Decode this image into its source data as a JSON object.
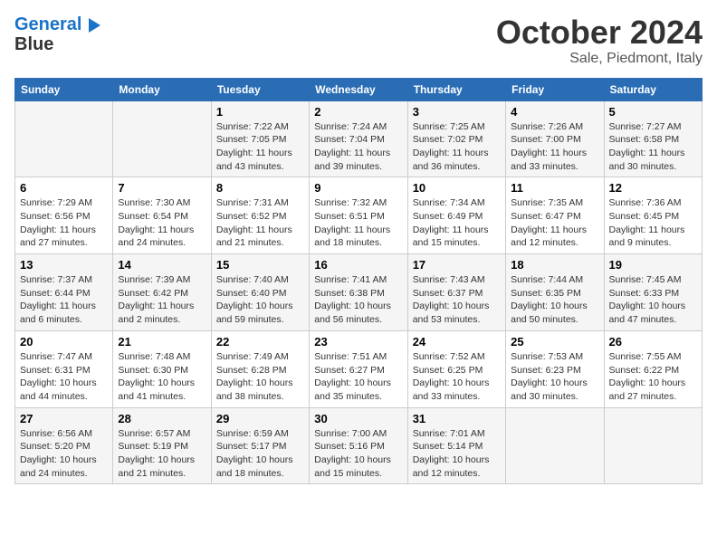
{
  "logo": {
    "line1": "General",
    "line2": "Blue"
  },
  "title": "October 2024",
  "location": "Sale, Piedmont, Italy",
  "headers": [
    "Sunday",
    "Monday",
    "Tuesday",
    "Wednesday",
    "Thursday",
    "Friday",
    "Saturday"
  ],
  "weeks": [
    [
      {
        "day": "",
        "sunrise": "",
        "sunset": "",
        "daylight": ""
      },
      {
        "day": "",
        "sunrise": "",
        "sunset": "",
        "daylight": ""
      },
      {
        "day": "1",
        "sunrise": "Sunrise: 7:22 AM",
        "sunset": "Sunset: 7:05 PM",
        "daylight": "Daylight: 11 hours and 43 minutes."
      },
      {
        "day": "2",
        "sunrise": "Sunrise: 7:24 AM",
        "sunset": "Sunset: 7:04 PM",
        "daylight": "Daylight: 11 hours and 39 minutes."
      },
      {
        "day": "3",
        "sunrise": "Sunrise: 7:25 AM",
        "sunset": "Sunset: 7:02 PM",
        "daylight": "Daylight: 11 hours and 36 minutes."
      },
      {
        "day": "4",
        "sunrise": "Sunrise: 7:26 AM",
        "sunset": "Sunset: 7:00 PM",
        "daylight": "Daylight: 11 hours and 33 minutes."
      },
      {
        "day": "5",
        "sunrise": "Sunrise: 7:27 AM",
        "sunset": "Sunset: 6:58 PM",
        "daylight": "Daylight: 11 hours and 30 minutes."
      }
    ],
    [
      {
        "day": "6",
        "sunrise": "Sunrise: 7:29 AM",
        "sunset": "Sunset: 6:56 PM",
        "daylight": "Daylight: 11 hours and 27 minutes."
      },
      {
        "day": "7",
        "sunrise": "Sunrise: 7:30 AM",
        "sunset": "Sunset: 6:54 PM",
        "daylight": "Daylight: 11 hours and 24 minutes."
      },
      {
        "day": "8",
        "sunrise": "Sunrise: 7:31 AM",
        "sunset": "Sunset: 6:52 PM",
        "daylight": "Daylight: 11 hours and 21 minutes."
      },
      {
        "day": "9",
        "sunrise": "Sunrise: 7:32 AM",
        "sunset": "Sunset: 6:51 PM",
        "daylight": "Daylight: 11 hours and 18 minutes."
      },
      {
        "day": "10",
        "sunrise": "Sunrise: 7:34 AM",
        "sunset": "Sunset: 6:49 PM",
        "daylight": "Daylight: 11 hours and 15 minutes."
      },
      {
        "day": "11",
        "sunrise": "Sunrise: 7:35 AM",
        "sunset": "Sunset: 6:47 PM",
        "daylight": "Daylight: 11 hours and 12 minutes."
      },
      {
        "day": "12",
        "sunrise": "Sunrise: 7:36 AM",
        "sunset": "Sunset: 6:45 PM",
        "daylight": "Daylight: 11 hours and 9 minutes."
      }
    ],
    [
      {
        "day": "13",
        "sunrise": "Sunrise: 7:37 AM",
        "sunset": "Sunset: 6:44 PM",
        "daylight": "Daylight: 11 hours and 6 minutes."
      },
      {
        "day": "14",
        "sunrise": "Sunrise: 7:39 AM",
        "sunset": "Sunset: 6:42 PM",
        "daylight": "Daylight: 11 hours and 2 minutes."
      },
      {
        "day": "15",
        "sunrise": "Sunrise: 7:40 AM",
        "sunset": "Sunset: 6:40 PM",
        "daylight": "Daylight: 10 hours and 59 minutes."
      },
      {
        "day": "16",
        "sunrise": "Sunrise: 7:41 AM",
        "sunset": "Sunset: 6:38 PM",
        "daylight": "Daylight: 10 hours and 56 minutes."
      },
      {
        "day": "17",
        "sunrise": "Sunrise: 7:43 AM",
        "sunset": "Sunset: 6:37 PM",
        "daylight": "Daylight: 10 hours and 53 minutes."
      },
      {
        "day": "18",
        "sunrise": "Sunrise: 7:44 AM",
        "sunset": "Sunset: 6:35 PM",
        "daylight": "Daylight: 10 hours and 50 minutes."
      },
      {
        "day": "19",
        "sunrise": "Sunrise: 7:45 AM",
        "sunset": "Sunset: 6:33 PM",
        "daylight": "Daylight: 10 hours and 47 minutes."
      }
    ],
    [
      {
        "day": "20",
        "sunrise": "Sunrise: 7:47 AM",
        "sunset": "Sunset: 6:31 PM",
        "daylight": "Daylight: 10 hours and 44 minutes."
      },
      {
        "day": "21",
        "sunrise": "Sunrise: 7:48 AM",
        "sunset": "Sunset: 6:30 PM",
        "daylight": "Daylight: 10 hours and 41 minutes."
      },
      {
        "day": "22",
        "sunrise": "Sunrise: 7:49 AM",
        "sunset": "Sunset: 6:28 PM",
        "daylight": "Daylight: 10 hours and 38 minutes."
      },
      {
        "day": "23",
        "sunrise": "Sunrise: 7:51 AM",
        "sunset": "Sunset: 6:27 PM",
        "daylight": "Daylight: 10 hours and 35 minutes."
      },
      {
        "day": "24",
        "sunrise": "Sunrise: 7:52 AM",
        "sunset": "Sunset: 6:25 PM",
        "daylight": "Daylight: 10 hours and 33 minutes."
      },
      {
        "day": "25",
        "sunrise": "Sunrise: 7:53 AM",
        "sunset": "Sunset: 6:23 PM",
        "daylight": "Daylight: 10 hours and 30 minutes."
      },
      {
        "day": "26",
        "sunrise": "Sunrise: 7:55 AM",
        "sunset": "Sunset: 6:22 PM",
        "daylight": "Daylight: 10 hours and 27 minutes."
      }
    ],
    [
      {
        "day": "27",
        "sunrise": "Sunrise: 6:56 AM",
        "sunset": "Sunset: 5:20 PM",
        "daylight": "Daylight: 10 hours and 24 minutes."
      },
      {
        "day": "28",
        "sunrise": "Sunrise: 6:57 AM",
        "sunset": "Sunset: 5:19 PM",
        "daylight": "Daylight: 10 hours and 21 minutes."
      },
      {
        "day": "29",
        "sunrise": "Sunrise: 6:59 AM",
        "sunset": "Sunset: 5:17 PM",
        "daylight": "Daylight: 10 hours and 18 minutes."
      },
      {
        "day": "30",
        "sunrise": "Sunrise: 7:00 AM",
        "sunset": "Sunset: 5:16 PM",
        "daylight": "Daylight: 10 hours and 15 minutes."
      },
      {
        "day": "31",
        "sunrise": "Sunrise: 7:01 AM",
        "sunset": "Sunset: 5:14 PM",
        "daylight": "Daylight: 10 hours and 12 minutes."
      },
      {
        "day": "",
        "sunrise": "",
        "sunset": "",
        "daylight": ""
      },
      {
        "day": "",
        "sunrise": "",
        "sunset": "",
        "daylight": ""
      }
    ]
  ]
}
